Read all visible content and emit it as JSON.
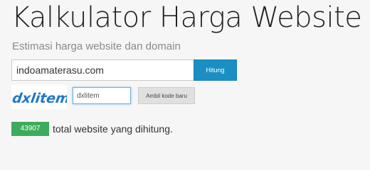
{
  "header": {
    "title": "Kalkulator Harga Website",
    "subtitle": "Estimasi harga website dan domain"
  },
  "form": {
    "url_value": "indoamaterasu.com",
    "submit_label": "Hitung",
    "captcha_image_text": "dxlitem",
    "captcha_value": "dxlitem",
    "new_code_label": "Ambil kode baru"
  },
  "stats": {
    "count": "43907",
    "count_label": "total website yang dihitung."
  },
  "colors": {
    "primary_button": "#1b8fc4",
    "badge_green": "#3dab5c",
    "captcha_text": "#1f78c8"
  }
}
